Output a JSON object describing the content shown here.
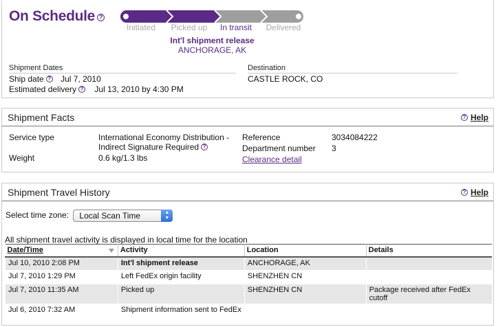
{
  "status": {
    "title": "On Schedule",
    "steps": [
      "Initiated",
      "Picked up",
      "In transit",
      "Delivered"
    ],
    "active_step_index": 2,
    "current_activity": "Int'l shipment release",
    "current_location": "ANCHORAGE, AK"
  },
  "dates": {
    "heading": "Shipment Dates",
    "ship_date_label": "Ship date",
    "ship_date_value": "Jul 7, 2010",
    "estimated_label": "Estimated delivery",
    "estimated_value": "Jul 13, 2010 by 4:30 PM"
  },
  "destination": {
    "heading": "Destination",
    "value": "CASTLE ROCK, CO"
  },
  "facts": {
    "title": "Shipment Facts",
    "help_label": "Help",
    "service_type_label": "Service type",
    "service_type_line1": "International Economy Distribution -",
    "service_type_line2": "Indirect Signature Required",
    "weight_label": "Weight",
    "weight_value": "0.6 kg/1.3 lbs",
    "reference_label": "Reference",
    "reference_value": "3034084222",
    "department_label": "Department number",
    "department_value": "3",
    "clearance_link": "Clearance detail"
  },
  "history": {
    "title": "Shipment Travel History",
    "help_label": "Help",
    "timezone_label": "Select time zone:",
    "timezone_value": "Local Scan Time",
    "note": "All shipment travel activity is displayed in local time for the location",
    "columns": [
      "Date/Time",
      "Activity",
      "Location",
      "Details"
    ],
    "rows": [
      {
        "datetime": "Jul 10, 2010 2:08 PM",
        "activity": "Int'l shipment release",
        "location": "ANCHORAGE, AK",
        "details": ""
      },
      {
        "datetime": "Jul 7, 2010 1:29 PM",
        "activity": "Left FedEx origin facility",
        "location": "SHENZHEN CN",
        "details": ""
      },
      {
        "datetime": "Jul 7, 2010 11:35 AM",
        "activity": "Picked up",
        "location": "SHENZHEN CN",
        "details": "Package received after FedEx cutoff"
      },
      {
        "datetime": "Jul 6, 2010 7:32 AM",
        "activity": "Shipment information sent to FedEx",
        "location": "",
        "details": ""
      }
    ]
  },
  "colors": {
    "brand_purple": "#5a2d82",
    "inactive_gray": "#a9a9a9"
  }
}
